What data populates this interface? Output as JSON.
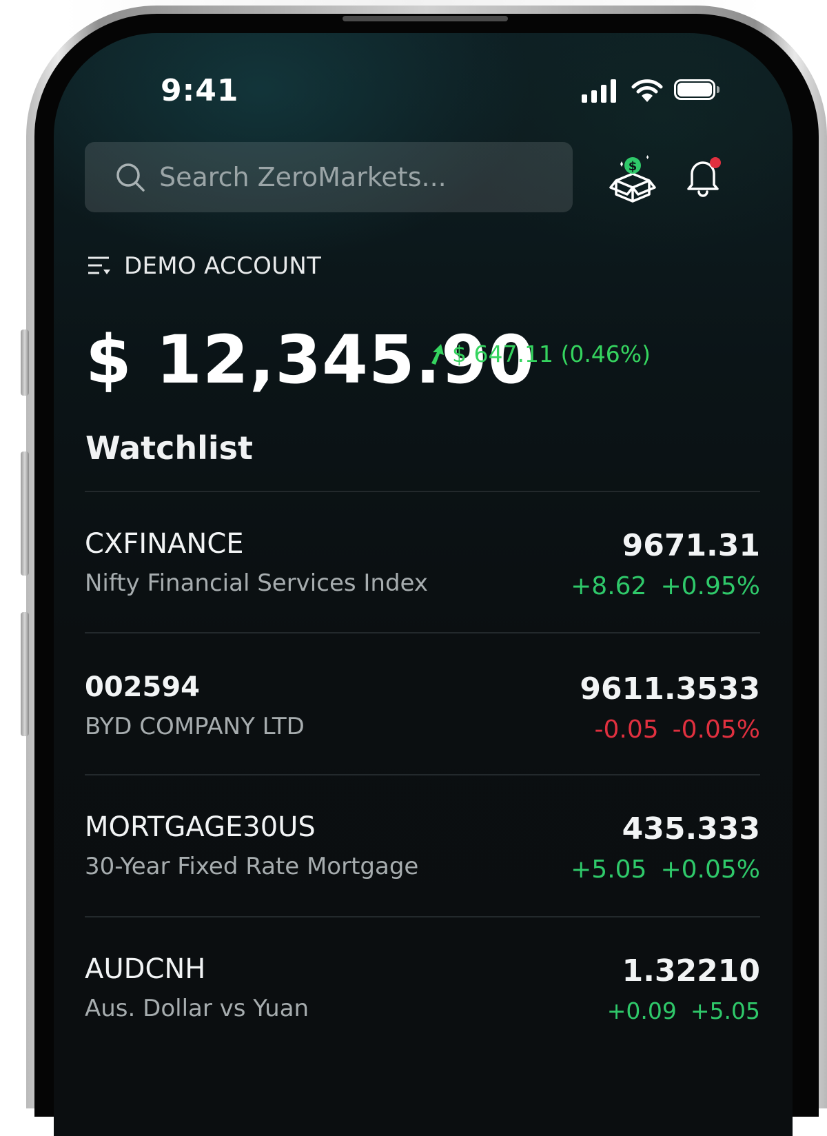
{
  "status_bar": {
    "time": "9:41"
  },
  "header": {
    "search": {
      "placeholder": "Search ZeroMarkets..."
    },
    "rewards_icon": "gift-box-dollar-icon",
    "notification_icon": "bell-icon",
    "notification_dot_color": "#e0303f"
  },
  "account": {
    "label": "DEMO ACCOUNT",
    "icon": "filter-menu-icon"
  },
  "balance": {
    "amount": "$ 12,345.90",
    "change": "$ 647.11 (0.46%)",
    "change_color": "#35d45f"
  },
  "watchlist": {
    "title": "Watchlist",
    "items": [
      {
        "symbol": "CXFINANCE",
        "name": "Nifty Financial Services Index",
        "price": "9671.31",
        "change": "+8.62",
        "change_pct": "+0.95%",
        "direction": "up"
      },
      {
        "symbol": "002594",
        "name": "BYD COMPANY LTD",
        "price": "9611.3533",
        "change": "-0.05",
        "change_pct": "-0.05%",
        "direction": "down"
      },
      {
        "symbol": "MORTGAGE30US",
        "name": "30-Year Fixed Rate Mortgage",
        "price": "435.333",
        "change": "+5.05",
        "change_pct": "+0.05%",
        "direction": "up"
      },
      {
        "symbol": "AUDCNH",
        "name": "Aus. Dollar vs Yuan",
        "price": "1.32210",
        "change": "+0.09",
        "change_pct": "+5.05",
        "direction": "up"
      }
    ]
  }
}
